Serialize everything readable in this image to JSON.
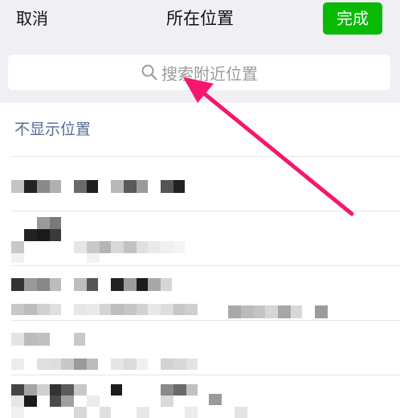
{
  "header": {
    "cancel_label": "取消",
    "title": "所在位置",
    "done_label": "完成",
    "done_color": "#09bb07"
  },
  "search": {
    "placeholder": "搜索附近位置",
    "icon": "search-icon"
  },
  "locations": {
    "hide_location_label": "不显示位置",
    "link_color": "#576b95"
  },
  "annotation": {
    "arrow_color": "#f6166e",
    "icon": "arrow-annotation"
  }
}
